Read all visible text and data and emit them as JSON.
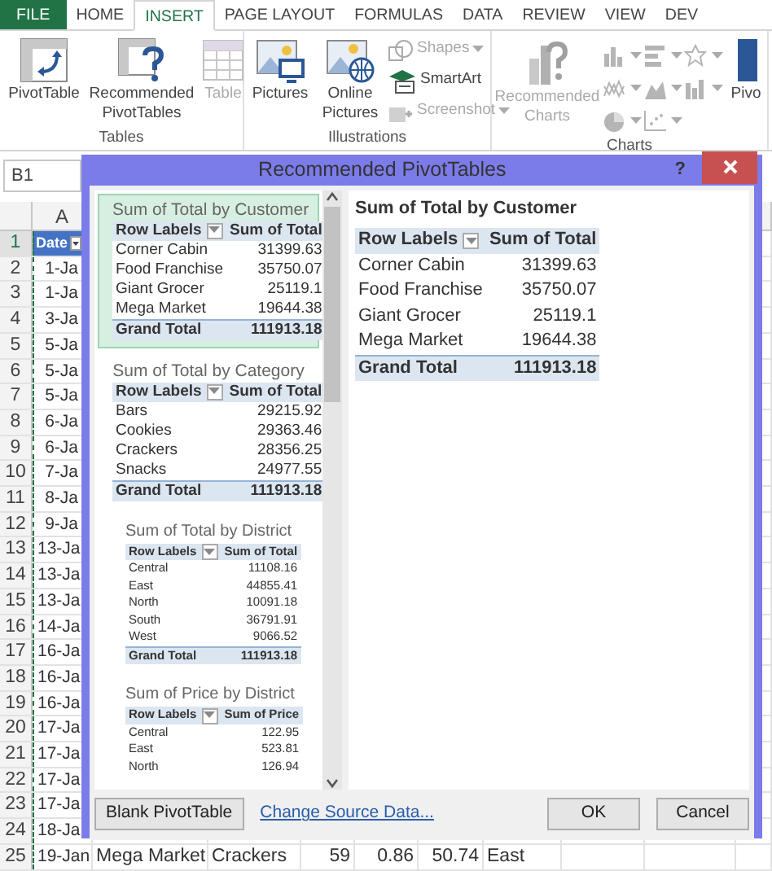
{
  "ribbon": {
    "tabs": [
      {
        "label": "FILE",
        "kind": "file",
        "selected": false
      },
      {
        "label": "HOME",
        "kind": "tab",
        "selected": false
      },
      {
        "label": "INSERT",
        "kind": "tab",
        "selected": true
      },
      {
        "label": "PAGE LAYOUT",
        "kind": "tab",
        "selected": false
      },
      {
        "label": "FORMULAS",
        "kind": "tab",
        "selected": false
      },
      {
        "label": "DATA",
        "kind": "tab",
        "selected": false
      },
      {
        "label": "REVIEW",
        "kind": "tab",
        "selected": false
      },
      {
        "label": "VIEW",
        "kind": "tab",
        "selected": false
      },
      {
        "label": "DEV",
        "kind": "tab",
        "selected": false
      }
    ],
    "groups": [
      {
        "label": "Tables",
        "buttons": [
          {
            "label": "PivotTable",
            "kind": "large",
            "disabled": false
          },
          {
            "label": "Recommended PivotTables",
            "kind": "large",
            "disabled": false
          },
          {
            "label": "Table",
            "kind": "large",
            "disabled": true
          }
        ]
      },
      {
        "label": "Illustrations",
        "buttons": [
          {
            "label": "Pictures",
            "kind": "large",
            "disabled": false
          },
          {
            "label": "Online Pictures",
            "kind": "large",
            "disabled": false
          },
          {
            "kind": "stack",
            "items": [
              {
                "label": "Shapes",
                "disabled": true,
                "dropdown": true
              },
              {
                "label": "SmartArt",
                "disabled": false,
                "dropdown": false
              },
              {
                "label": "Screenshot",
                "disabled": true,
                "dropdown": true
              }
            ]
          }
        ]
      },
      {
        "label": "Charts",
        "buttons": [
          {
            "label": "Recommended Charts",
            "kind": "large",
            "disabled": true
          },
          {
            "kind": "chart-icons",
            "disabled": true
          },
          {
            "label": "Pivo",
            "kind": "large",
            "disabled": false
          }
        ]
      }
    ]
  },
  "name_box": "B1",
  "sheet": {
    "columns": [
      "A"
    ],
    "rows": [
      {
        "number": "1",
        "selected": true,
        "header": true,
        "cells": [
          "Date"
        ]
      },
      {
        "number": "2",
        "selected": false,
        "header": false,
        "cells": [
          "1-Ja"
        ]
      },
      {
        "number": "3",
        "selected": false,
        "header": false,
        "cells": [
          "1-Ja"
        ]
      },
      {
        "number": "4",
        "selected": false,
        "header": false,
        "cells": [
          "3-Ja"
        ]
      },
      {
        "number": "5",
        "selected": false,
        "header": false,
        "cells": [
          "5-Ja"
        ]
      },
      {
        "number": "6",
        "selected": false,
        "header": false,
        "cells": [
          "5-Ja"
        ]
      },
      {
        "number": "7",
        "selected": false,
        "header": false,
        "cells": [
          "5-Ja"
        ]
      },
      {
        "number": "8",
        "selected": false,
        "header": false,
        "cells": [
          "6-Ja"
        ]
      },
      {
        "number": "9",
        "selected": false,
        "header": false,
        "cells": [
          "6-Ja"
        ]
      },
      {
        "number": "10",
        "selected": false,
        "header": false,
        "cells": [
          "7-Ja"
        ]
      },
      {
        "number": "11",
        "selected": false,
        "header": false,
        "cells": [
          "8-Ja"
        ]
      },
      {
        "number": "12",
        "selected": false,
        "header": false,
        "cells": [
          "9-Ja"
        ]
      },
      {
        "number": "13",
        "selected": false,
        "header": false,
        "cells": [
          "13-Ja"
        ]
      },
      {
        "number": "14",
        "selected": false,
        "header": false,
        "cells": [
          "13-Ja"
        ]
      },
      {
        "number": "15",
        "selected": false,
        "header": false,
        "cells": [
          "13-Ja"
        ]
      },
      {
        "number": "16",
        "selected": false,
        "header": false,
        "cells": [
          "14-Ja"
        ]
      },
      {
        "number": "17",
        "selected": false,
        "header": false,
        "cells": [
          "16-Ja"
        ]
      },
      {
        "number": "18",
        "selected": false,
        "header": false,
        "cells": [
          "16-Ja"
        ]
      },
      {
        "number": "19",
        "selected": false,
        "header": false,
        "cells": [
          "16-Ja"
        ]
      },
      {
        "number": "20",
        "selected": false,
        "header": false,
        "cells": [
          "17-Ja"
        ]
      },
      {
        "number": "21",
        "selected": false,
        "header": false,
        "cells": [
          "17-Ja"
        ]
      },
      {
        "number": "22",
        "selected": false,
        "header": false,
        "cells": [
          "17-Ja"
        ]
      },
      {
        "number": "23",
        "selected": false,
        "header": false,
        "cells": [
          "17-Ja"
        ]
      },
      {
        "number": "24",
        "selected": false,
        "header": false,
        "cells": [
          "18-Ja"
        ]
      },
      {
        "number": "25",
        "selected": false,
        "header": false,
        "cells": [
          "19-Jan",
          "Mega Market",
          "Crackers",
          "59",
          "0.86",
          "50.74",
          "East"
        ]
      }
    ]
  },
  "dialog": {
    "title": "Recommended PivotTables",
    "help": "?",
    "recommendations": [
      {
        "title": "Sum of Total by Customer",
        "selected": true,
        "columns": [
          "Row Labels",
          "Sum of Total"
        ],
        "rows": [
          [
            "Corner Cabin",
            "31399.63"
          ],
          [
            "Food Franchise",
            "35750.07"
          ],
          [
            "Giant Grocer",
            "25119.1"
          ],
          [
            "Mega Market",
            "19644.38"
          ]
        ],
        "total": [
          "Grand Total",
          "111913.18"
        ]
      },
      {
        "title": "Sum of Total by Category",
        "selected": false,
        "columns": [
          "Row Labels",
          "Sum of Total"
        ],
        "rows": [
          [
            "Bars",
            "29215.92"
          ],
          [
            "Cookies",
            "29363.46"
          ],
          [
            "Crackers",
            "28356.25"
          ],
          [
            "Snacks",
            "24977.55"
          ]
        ],
        "total": [
          "Grand Total",
          "111913.18"
        ]
      },
      {
        "title": "Sum of Total by District",
        "selected": false,
        "columns": [
          "Row Labels",
          "Sum of Total"
        ],
        "rows": [
          [
            "Central",
            "11108.16"
          ],
          [
            "East",
            "44855.41"
          ],
          [
            "North",
            "10091.18"
          ],
          [
            "South",
            "36791.91"
          ],
          [
            "West",
            "9066.52"
          ]
        ],
        "total": [
          "Grand Total",
          "111913.18"
        ]
      },
      {
        "title": "Sum of Price by District",
        "selected": false,
        "columns": [
          "Row Labels",
          "Sum of Price"
        ],
        "rows": [
          [
            "Central",
            "122.95"
          ],
          [
            "East",
            "523.81"
          ],
          [
            "North",
            "126.94"
          ]
        ]
      }
    ],
    "preview": {
      "title": "Sum of Total by Customer",
      "columns": [
        "Row Labels",
        "Sum of Total"
      ],
      "rows": [
        [
          "Corner Cabin",
          "31399.63"
        ],
        [
          "Food Franchise",
          "35750.07"
        ],
        [
          "Giant Grocer",
          "25119.1"
        ],
        [
          "Mega Market",
          "19644.38"
        ]
      ],
      "total": [
        "Grand Total",
        "111913.18"
      ]
    },
    "footer": [
      {
        "label": "Blank PivotTable",
        "kind": "button"
      },
      {
        "label": "Change Source Data...",
        "kind": "link"
      },
      {
        "label": "OK",
        "kind": "button"
      },
      {
        "label": "Cancel",
        "kind": "button"
      }
    ]
  }
}
